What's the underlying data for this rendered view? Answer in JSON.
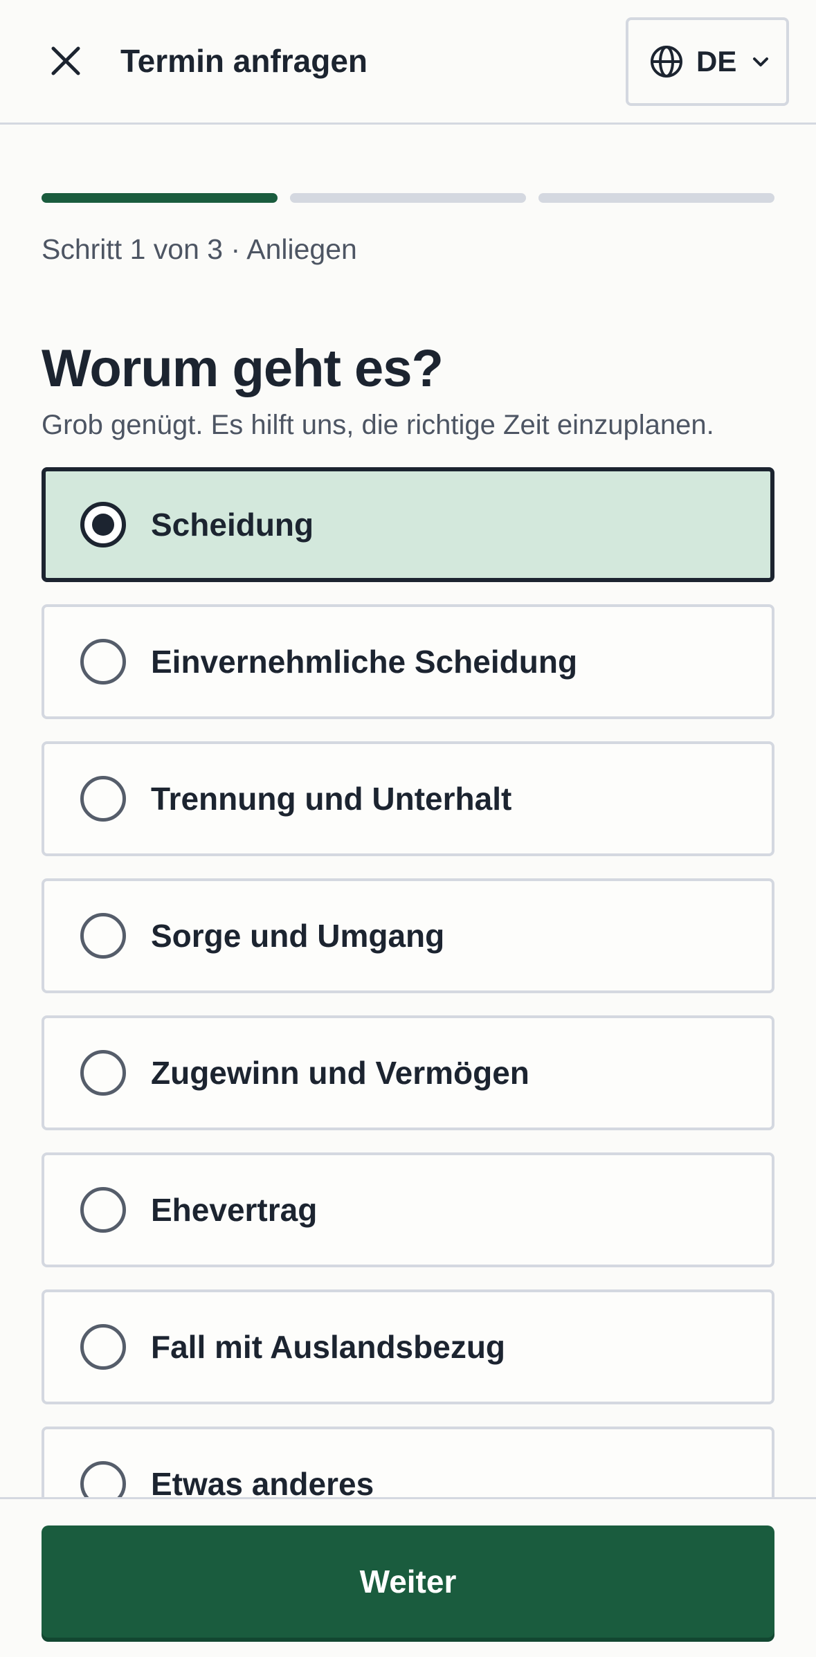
{
  "header": {
    "title": "Termin anfragen",
    "language": "DE",
    "icons": {
      "close": "close-icon",
      "language": "globe-icon",
      "dropdown": "chevron-down-icon"
    }
  },
  "progress": {
    "current_step": 1,
    "total_steps": 3,
    "step_text": "Schritt 1 von 3 · Anliegen"
  },
  "question": {
    "title": "Worum geht es?",
    "hint": "Grob genügt. Es hilft uns, die richtige Zeit einzuplanen."
  },
  "options": [
    {
      "label": "Scheidung",
      "selected": true
    },
    {
      "label": "Einvernehmliche Scheidung",
      "selected": false
    },
    {
      "label": "Trennung und Unterhalt",
      "selected": false
    },
    {
      "label": "Sorge und Umgang",
      "selected": false
    },
    {
      "label": "Zugewinn und Vermögen",
      "selected": false
    },
    {
      "label": "Ehevertrag",
      "selected": false
    },
    {
      "label": "Fall mit Auslandsbezug",
      "selected": false
    },
    {
      "label": "Etwas anderes",
      "selected": false
    }
  ],
  "footer": {
    "next_label": "Weiter"
  },
  "colors": {
    "primary": "#1a5c3e",
    "selected_background": "#d3e8dc",
    "text": "#1c2430",
    "muted_text": "#4d5563",
    "border": "#d4d8e0"
  }
}
